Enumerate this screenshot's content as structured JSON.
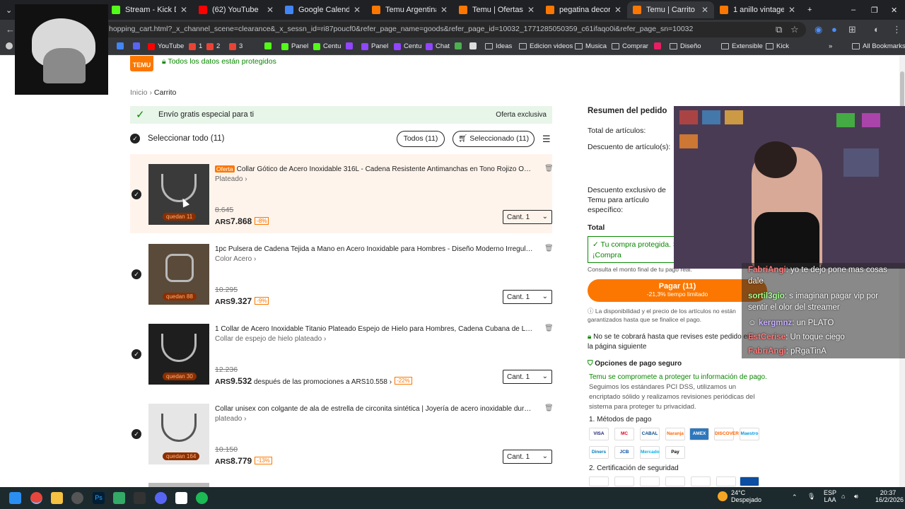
{
  "tabs": [
    {
      "title": "Stream - Kick Da",
      "color": "#53fc18",
      "active": false
    },
    {
      "title": "(62) YouTube",
      "color": "#ff0000",
      "active": false
    },
    {
      "title": "Google Calendar - fe",
      "color": "#4285f4",
      "active": false
    },
    {
      "title": "Temu Argentina | Exp",
      "color": "#fb7701",
      "active": false
    },
    {
      "title": "Temu | Ofertas de liq",
      "color": "#fb7701",
      "active": false
    },
    {
      "title": "pegatina decorativa",
      "color": "#fb7701",
      "active": false
    },
    {
      "title": "Temu | Carrito de co",
      "color": "#fb7701",
      "active": true
    },
    {
      "title": "1 anillo vintage topa",
      "color": "#fb7701",
      "active": false
    }
  ],
  "url": "hopping_cart.html?_x_channel_scene=clearance&_x_sessn_id=ri87poucf0&refer_page_name=goods&refer_page_id=10032_1771285050359_c61ifaqo0i&refer_page_sn=10032",
  "bookmarks": [
    "YouTube",
    "1",
    "2",
    "3",
    "Panel",
    "Centu",
    "Panel",
    "Centu",
    "Chat",
    "Ideas",
    "Edicion videos",
    "Musica",
    "Comprar",
    "Diseño",
    "Extensible",
    "Kick",
    "All Bookmarks"
  ],
  "header": {
    "logo": "TEMU",
    "secure": "Todos los datos están protegidos"
  },
  "breadcrumb": {
    "home": "Inicio",
    "sep": "›",
    "current": "Carrito"
  },
  "shipping": {
    "text": "Envío gratis especial para ti",
    "right": "Oferta exclusiva"
  },
  "select_all": "Seleccionar todo (11)",
  "filters": {
    "all": "Todos (11)",
    "selected": "Seleccionado (11)"
  },
  "items": [
    {
      "badge": "Oferta",
      "name": "Collar Gótico de Acero Inoxidable 316L - Cadena Resistente Antimanchas en Tono Rojizo Oscuro, ...",
      "variant": "Plateado ›",
      "left": "quedan 11",
      "old": "8.645",
      "cur": "ARS",
      "new": "7.868",
      "promo": "",
      "disc": "-8%",
      "qty": "Cant. 1"
    },
    {
      "badge": "",
      "name": "1pc Pulsera de Cadena Tejida a Mano en Acero Inoxidable para Hombres - Diseño Moderno Irregular y Fresc...",
      "variant": "Color Acero ›",
      "left": "quedan 88",
      "old": "10.295",
      "cur": "ARS",
      "new": "9.327",
      "promo": "",
      "disc": "-9%",
      "qty": "Cant. 1"
    },
    {
      "badge": "",
      "name": "1 Collar de Acero Inoxidable Titanio Plateado Espejo de Hielo para Hombres, Cadena Cubana de Lujo Ligero ...",
      "variant": "Collar de espejo de hielo plateado ›",
      "left": "quedan 30",
      "old": "12.236",
      "cur": "ARS",
      "new": "9.532",
      "promo": " después de las promociones a ARS10.558 ›",
      "disc": "-22%",
      "qty": "Cant. 1"
    },
    {
      "badge": "",
      "name": "Collar unisex con colgante de ala de estrella de circonita sintética | Joyería de acero inoxidable duradera y re...",
      "variant": "plateado ›",
      "left": "quedan 164",
      "old": "10.150",
      "cur": "ARS",
      "new": "8.779",
      "promo": "",
      "disc": "-13%",
      "qty": "Cant. 1"
    }
  ],
  "summary": {
    "title": "Resumen del pedido",
    "total_items": "Total de artículos:",
    "discount": "Descuento de artículo(s):",
    "exclusive": "Descuento exclusivo de Temu para artículo específico:",
    "total": "Total",
    "protect": "Tu compra protegida. S te lo igualamos. ¡Compra",
    "consult": "Consulta el monto final de tu pago real.",
    "pay": "Pagar (11)",
    "pay_sub": "-21,3% tiempo limitado",
    "availability": "La disponibilidad y el precio de los artículos no están garantizados hasta que se finalice el pago.",
    "no_charge": "No se te cobrará hasta que revises este pedido en la página siguiente",
    "secure_opts": "Opciones de pago seguro",
    "commit": "Temu se compromete a proteger tu información de pago.",
    "pci": "Seguimos los estándares PCI DSS, utilizamos un encriptado sólido y realizamos revisiones periódicas del sistema para proteger tu privacidad.",
    "methods": "1. Métodos de pago",
    "cert": "2. Certificación de seguridad",
    "cards": [
      "VISA",
      "MC",
      "CABAL",
      "Naranja",
      "AMEX",
      "DISCOVER",
      "Maestro",
      "Diners",
      "JCB",
      "Mercado",
      "Pay"
    ]
  },
  "chat": [
    {
      "user": "FabriAngi",
      "text": ": yo te dejo pone mas cosas dale"
    },
    {
      "user": "sortil3gio",
      "text": ": s imaginan pagar vip por sentir el olor del streamer"
    },
    {
      "user": "kergmnz",
      "text": ": un PLATO"
    },
    {
      "user": "EstCerise",
      "text": ": Un toque ciego"
    },
    {
      "user": "FabriAngi",
      "text": ": pRgaTinA"
    }
  ],
  "taskbar": {
    "weather": "24°C",
    "weather_desc": "Despejado",
    "lang": "ESP",
    "lang2": "LAA",
    "time": "20:37",
    "date": "16/2/2026"
  }
}
